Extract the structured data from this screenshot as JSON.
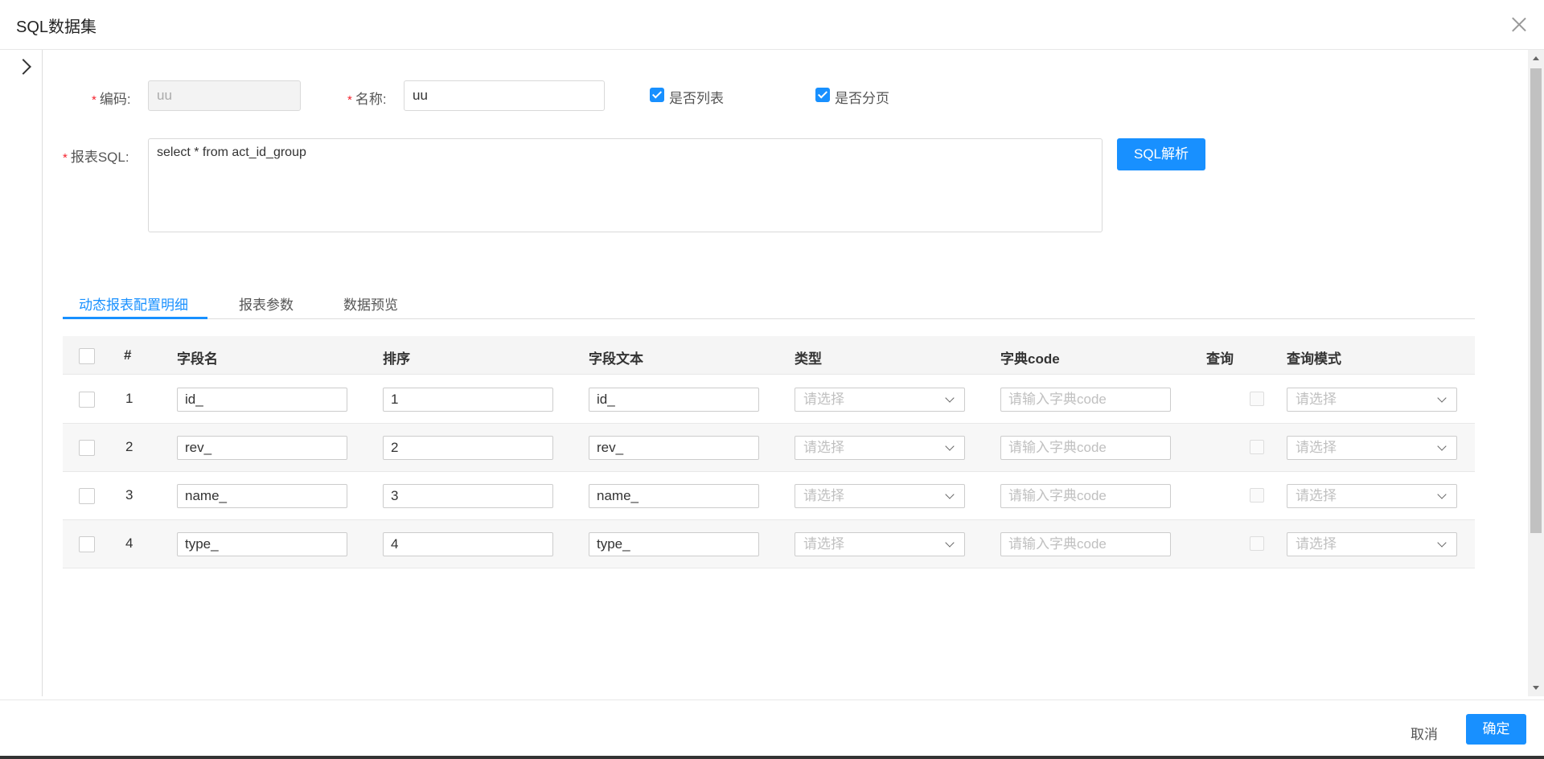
{
  "dialog": {
    "title": "SQL数据集"
  },
  "form": {
    "code_label": "编码:",
    "code_value": "uu",
    "name_label": "名称:",
    "name_value": "uu",
    "is_list_label": "是否列表",
    "is_paging_label": "是否分页",
    "sql_label": "报表SQL:",
    "sql_value": "select *  from act_id_group",
    "parse_button": "SQL解析",
    "required_mark": "*"
  },
  "tabs": [
    {
      "label": "动态报表配置明细",
      "active": true
    },
    {
      "label": "报表参数",
      "active": false
    },
    {
      "label": "数据预览",
      "active": false
    }
  ],
  "table": {
    "headers": [
      "#",
      "字段名",
      "排序",
      "字段文本",
      "类型",
      "字典code",
      "查询",
      "查询模式"
    ],
    "select_placeholder": "请选择",
    "dict_placeholder": "请输入字典code",
    "rows": [
      {
        "index": "1",
        "field": "id_",
        "order": "1",
        "text": "id_"
      },
      {
        "index": "2",
        "field": "rev_",
        "order": "2",
        "text": "rev_"
      },
      {
        "index": "3",
        "field": "name_",
        "order": "3",
        "text": "name_"
      },
      {
        "index": "4",
        "field": "type_",
        "order": "4",
        "text": "type_"
      }
    ]
  },
  "footer": {
    "cancel": "取消",
    "confirm": "确定"
  },
  "colors": {
    "primary": "#1890ff",
    "required": "#f5222d"
  }
}
